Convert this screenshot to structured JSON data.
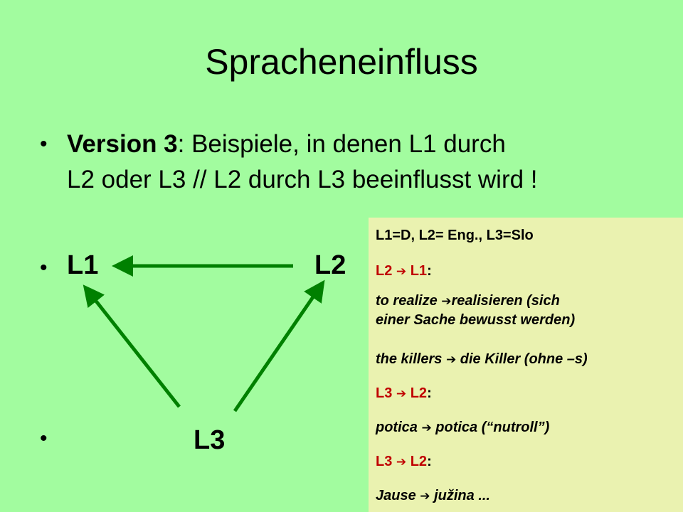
{
  "slide": {
    "title": "Spracheneinfluss",
    "bullet_char": "•",
    "bullet1": {
      "bold": "Version 3",
      "rest_line1": ": Beispiele, in denen L1 durch",
      "line2": "L2 oder L3 // L2 durch L3 beeinflusst wird !"
    },
    "nodes": {
      "l1": "L1",
      "l2": "L2",
      "l3": "L3"
    },
    "arrow_color": "#008000"
  },
  "box": {
    "header": "L1=D, L2= Eng., L3=Slo",
    "sec1": {
      "from": "L2",
      "arrow": "➔",
      "to": "L1",
      "colon": ":"
    },
    "ex1a": {
      "en": "to realize",
      "arrow": "➔",
      "de": "realisieren (sich"
    },
    "ex1b": "einer Sache bewusst werden)",
    "ex2": {
      "en": "the killers",
      "arrow": "➔",
      "de": "die Killer (ohne –s)"
    },
    "sec2": {
      "from": "L3",
      "arrow": "➔",
      "to": "L2",
      "colon": ":"
    },
    "ex3": {
      "a": "potica",
      "arrow": "➔",
      "b": "potica (“nutroll”)"
    },
    "sec3": {
      "from": "L3",
      "arrow": "➔",
      "to": "L2",
      "colon": ":"
    },
    "ex4": {
      "a": "Jause",
      "arrow": "➔",
      "b": "južina ..."
    },
    "red_color": "#c00000",
    "bg_color": "#eaf2b0"
  },
  "background_color": "#a2fc9f"
}
